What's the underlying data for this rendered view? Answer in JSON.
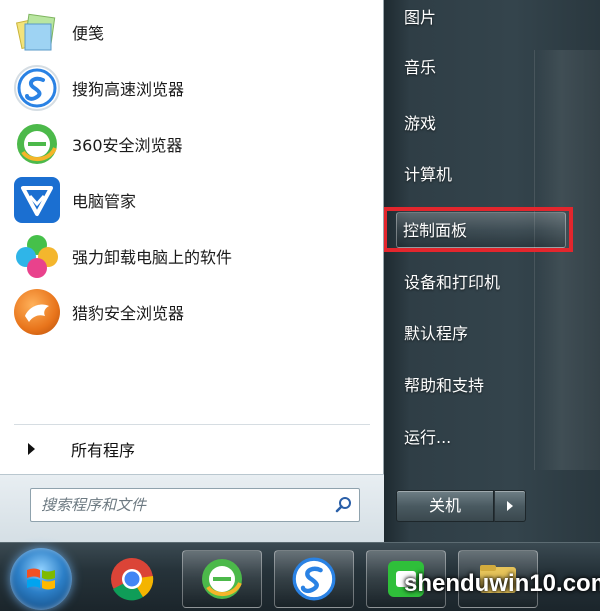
{
  "pinned_programs": [
    {
      "label": "便笺",
      "icon": "sticky-notes-icon"
    },
    {
      "label": "搜狗高速浏览器",
      "icon": "sogou-browser-icon"
    },
    {
      "label": "360安全浏览器",
      "icon": "360-browser-icon"
    },
    {
      "label": "电脑管家",
      "icon": "pc-manager-icon"
    },
    {
      "label": "强力卸载电脑上的软件",
      "icon": "uninstaller-icon"
    },
    {
      "label": "猎豹安全浏览器",
      "icon": "cheetah-browser-icon"
    }
  ],
  "all_programs_label": "所有程序",
  "search": {
    "placeholder": "搜索程序和文件"
  },
  "right_items": [
    {
      "label": "图片"
    },
    {
      "label": "音乐"
    },
    {
      "label": "游戏"
    },
    {
      "label": "计算机"
    },
    {
      "label": "控制面板",
      "highlighted": true
    },
    {
      "label": "设备和打印机"
    },
    {
      "label": "默认程序"
    },
    {
      "label": "帮助和支持"
    },
    {
      "label": "运行..."
    }
  ],
  "shutdown_label": "关机",
  "taskbar": {
    "items": [
      {
        "icon": "windows-start-orb-icon"
      },
      {
        "icon": "chrome-icon"
      },
      {
        "icon": "360-browser-icon"
      },
      {
        "icon": "sogou-browser-icon"
      },
      {
        "icon": "wechat-like-icon"
      },
      {
        "icon": "folder-icon"
      }
    ]
  },
  "watermark": "shenduwin10.com",
  "colors": {
    "highlight_box": "#e3262d",
    "accent": "#2c7fc7"
  }
}
